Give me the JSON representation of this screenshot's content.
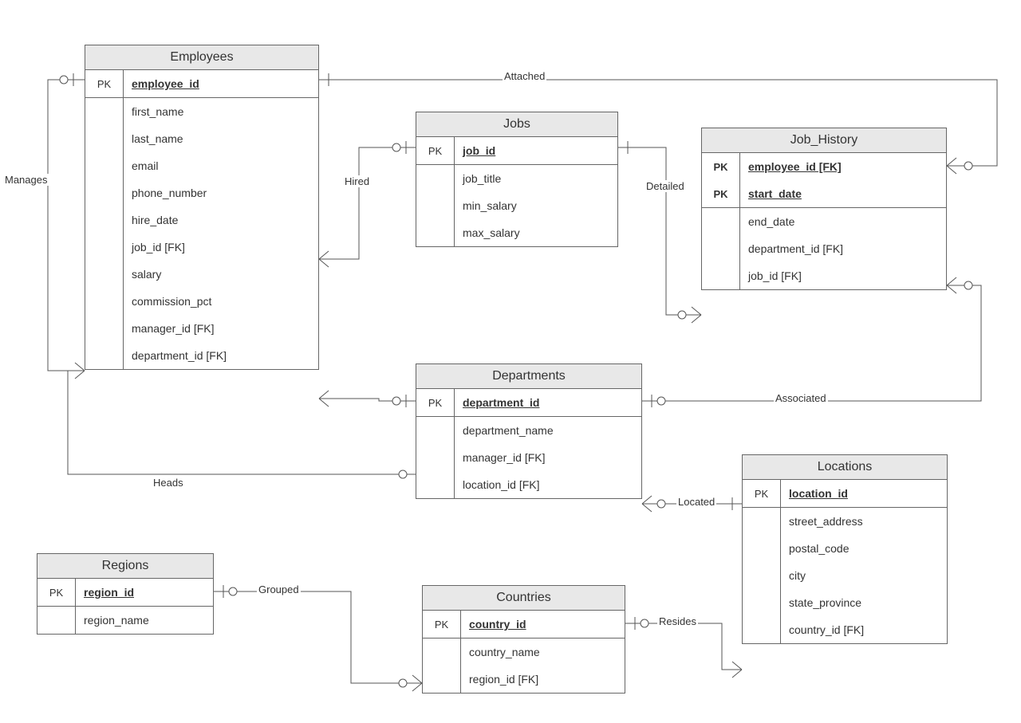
{
  "entities": {
    "employees": {
      "title": "Employees",
      "pk": [
        {
          "key": "PK",
          "name": "employee_id"
        }
      ],
      "attrs": [
        "first_name",
        "last_name",
        "email",
        "phone_number",
        "hire_date",
        "job_id [FK]",
        "salary",
        "commission_pct",
        "manager_id [FK]",
        "department_id [FK]"
      ]
    },
    "jobs": {
      "title": "Jobs",
      "pk": [
        {
          "key": "PK",
          "name": "job_id"
        }
      ],
      "attrs": [
        "job_title",
        "min_salary",
        "max_salary"
      ]
    },
    "job_history": {
      "title": "Job_History",
      "pk": [
        {
          "key": "PK",
          "name": "employee_id [FK]"
        },
        {
          "key": "PK",
          "name": "start_date"
        }
      ],
      "attrs": [
        "end_date",
        "department_id [FK]",
        "job_id [FK]"
      ]
    },
    "departments": {
      "title": "Departments",
      "pk": [
        {
          "key": "PK",
          "name": "department_id"
        }
      ],
      "attrs": [
        "department_name",
        "manager_id [FK]",
        "location_id [FK]"
      ]
    },
    "locations": {
      "title": "Locations",
      "pk": [
        {
          "key": "PK",
          "name": "location_id"
        }
      ],
      "attrs": [
        "street_address",
        "postal_code",
        "city",
        "state_province",
        "country_id [FK]"
      ]
    },
    "countries": {
      "title": "Countries",
      "pk": [
        {
          "key": "PK",
          "name": "country_id"
        }
      ],
      "attrs": [
        "country_name",
        "region_id [FK]"
      ]
    },
    "regions": {
      "title": "Regions",
      "pk": [
        {
          "key": "PK",
          "name": "region_id"
        }
      ],
      "attrs": [
        "region_name"
      ]
    }
  },
  "relationships": {
    "manages": "Manages",
    "attached": "Attached",
    "hired": "Hired",
    "detailed": "Detailed",
    "associated": "Associated",
    "heads": "Heads",
    "located": "Located",
    "resides": "Resides",
    "grouped": "Grouped"
  }
}
